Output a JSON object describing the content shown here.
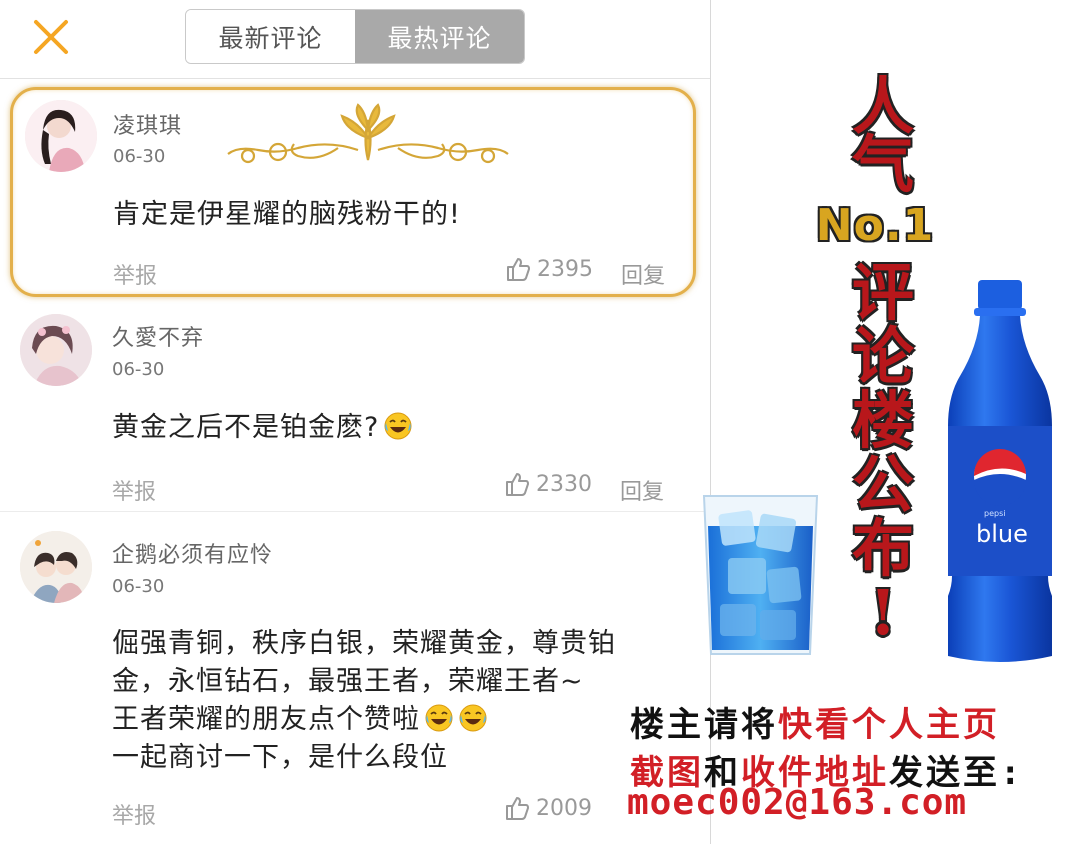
{
  "header": {
    "close_icon": "close-icon",
    "tabs": [
      {
        "label": "最新评论",
        "active": false
      },
      {
        "label": "最热评论",
        "active": true
      }
    ]
  },
  "comments": [
    {
      "username": "凌琪琪",
      "date": "06-30",
      "text_lines": [
        "肯定是伊星耀的脑残粉干的!"
      ],
      "report": "举报",
      "likes": "2395",
      "reply": "回复",
      "highlighted": true
    },
    {
      "username": "久愛不弃",
      "date": "06-30",
      "text_lines": [
        "黄金之后不是铂金麽?"
      ],
      "report": "举报",
      "likes": "2330",
      "reply": "回复",
      "highlighted": false
    },
    {
      "username": "企鹅必须有应怜",
      "date": "06-30",
      "text_lines": [
        "倔强青铜，秩序白银，荣耀黄金，尊贵铂",
        "金，永恒钻石，最强王者，荣耀王者~",
        "王者荣耀的朋友点个赞啦",
        "一起商讨一下，是什么段位"
      ],
      "report": "举报",
      "likes": "2009",
      "reply": "",
      "highlighted": false
    }
  ],
  "promo": {
    "title_chars_top": [
      "人",
      "气"
    ],
    "rank": "No.1",
    "title_chars_bottom": [
      "评",
      "论",
      "楼",
      "公",
      "布",
      "!"
    ],
    "bottle_label": "blue",
    "bottle_brand": "pepsi",
    "line1_black_a": "楼主请将",
    "line1_red": "快看个人主页",
    "line2_red_a": "截图",
    "line2_black_a": "和",
    "line2_red_b": "收件地址",
    "line2_black_b": "发送至:",
    "email": "moec002@163.com"
  },
  "colors": {
    "accent_orange": "#f5a623",
    "gold_border": "#e3b04b",
    "title_red": "#b8171b",
    "rank_gold": "#d8a520",
    "promo_red": "#d21f26",
    "pepsi_blue": "#1f56d6"
  }
}
